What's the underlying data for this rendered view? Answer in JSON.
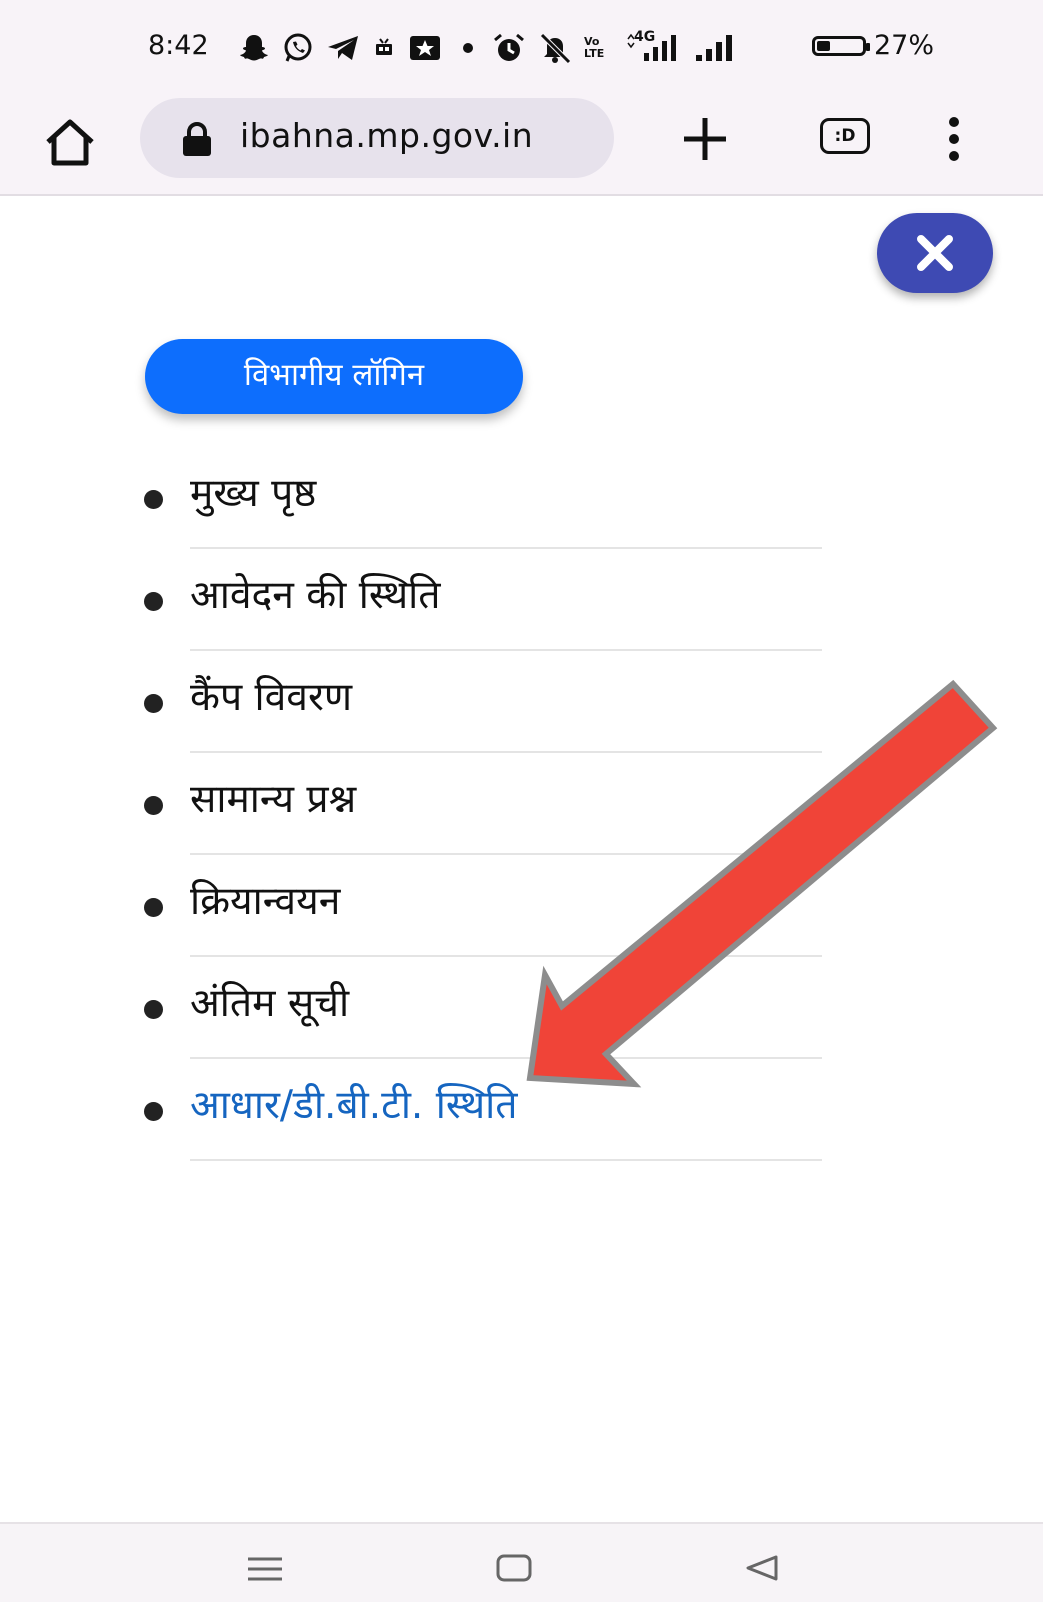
{
  "status_bar": {
    "time": "8:42",
    "network_label": "4G",
    "volte_label": "Vo LTE",
    "battery_percent": "27%",
    "battery_level": 0.27,
    "icons": [
      "snapchat-icon",
      "whatsapp-icon",
      "telegram-icon",
      "recording-icon",
      "news-icon",
      "dot-icon",
      "alarm-icon",
      "mute-icon",
      "volte-icon",
      "signal-4g-icon",
      "signal-icon",
      "battery-icon"
    ]
  },
  "browser": {
    "url": "ibahna.mp.gov.in",
    "tabs_label": ":D"
  },
  "login_button": {
    "label": "विभागीय लॉगिन"
  },
  "menu": {
    "items": [
      {
        "label": "मुख्य पृष्ठ"
      },
      {
        "label": "आवेदन की स्थिति"
      },
      {
        "label": "कैंप विवरण"
      },
      {
        "label": "सामान्य प्रश्न"
      },
      {
        "label": "क्रियान्वयन"
      },
      {
        "label": "अंतिम सूची"
      },
      {
        "label": "आधार/डी.बी.टी. स्थिति",
        "active": true
      }
    ]
  },
  "colors": {
    "primary_blue": "#0d6efd",
    "fab_indigo": "#3e4ab3",
    "active_link": "#1565c0",
    "annotation_arrow": "#f04438"
  }
}
